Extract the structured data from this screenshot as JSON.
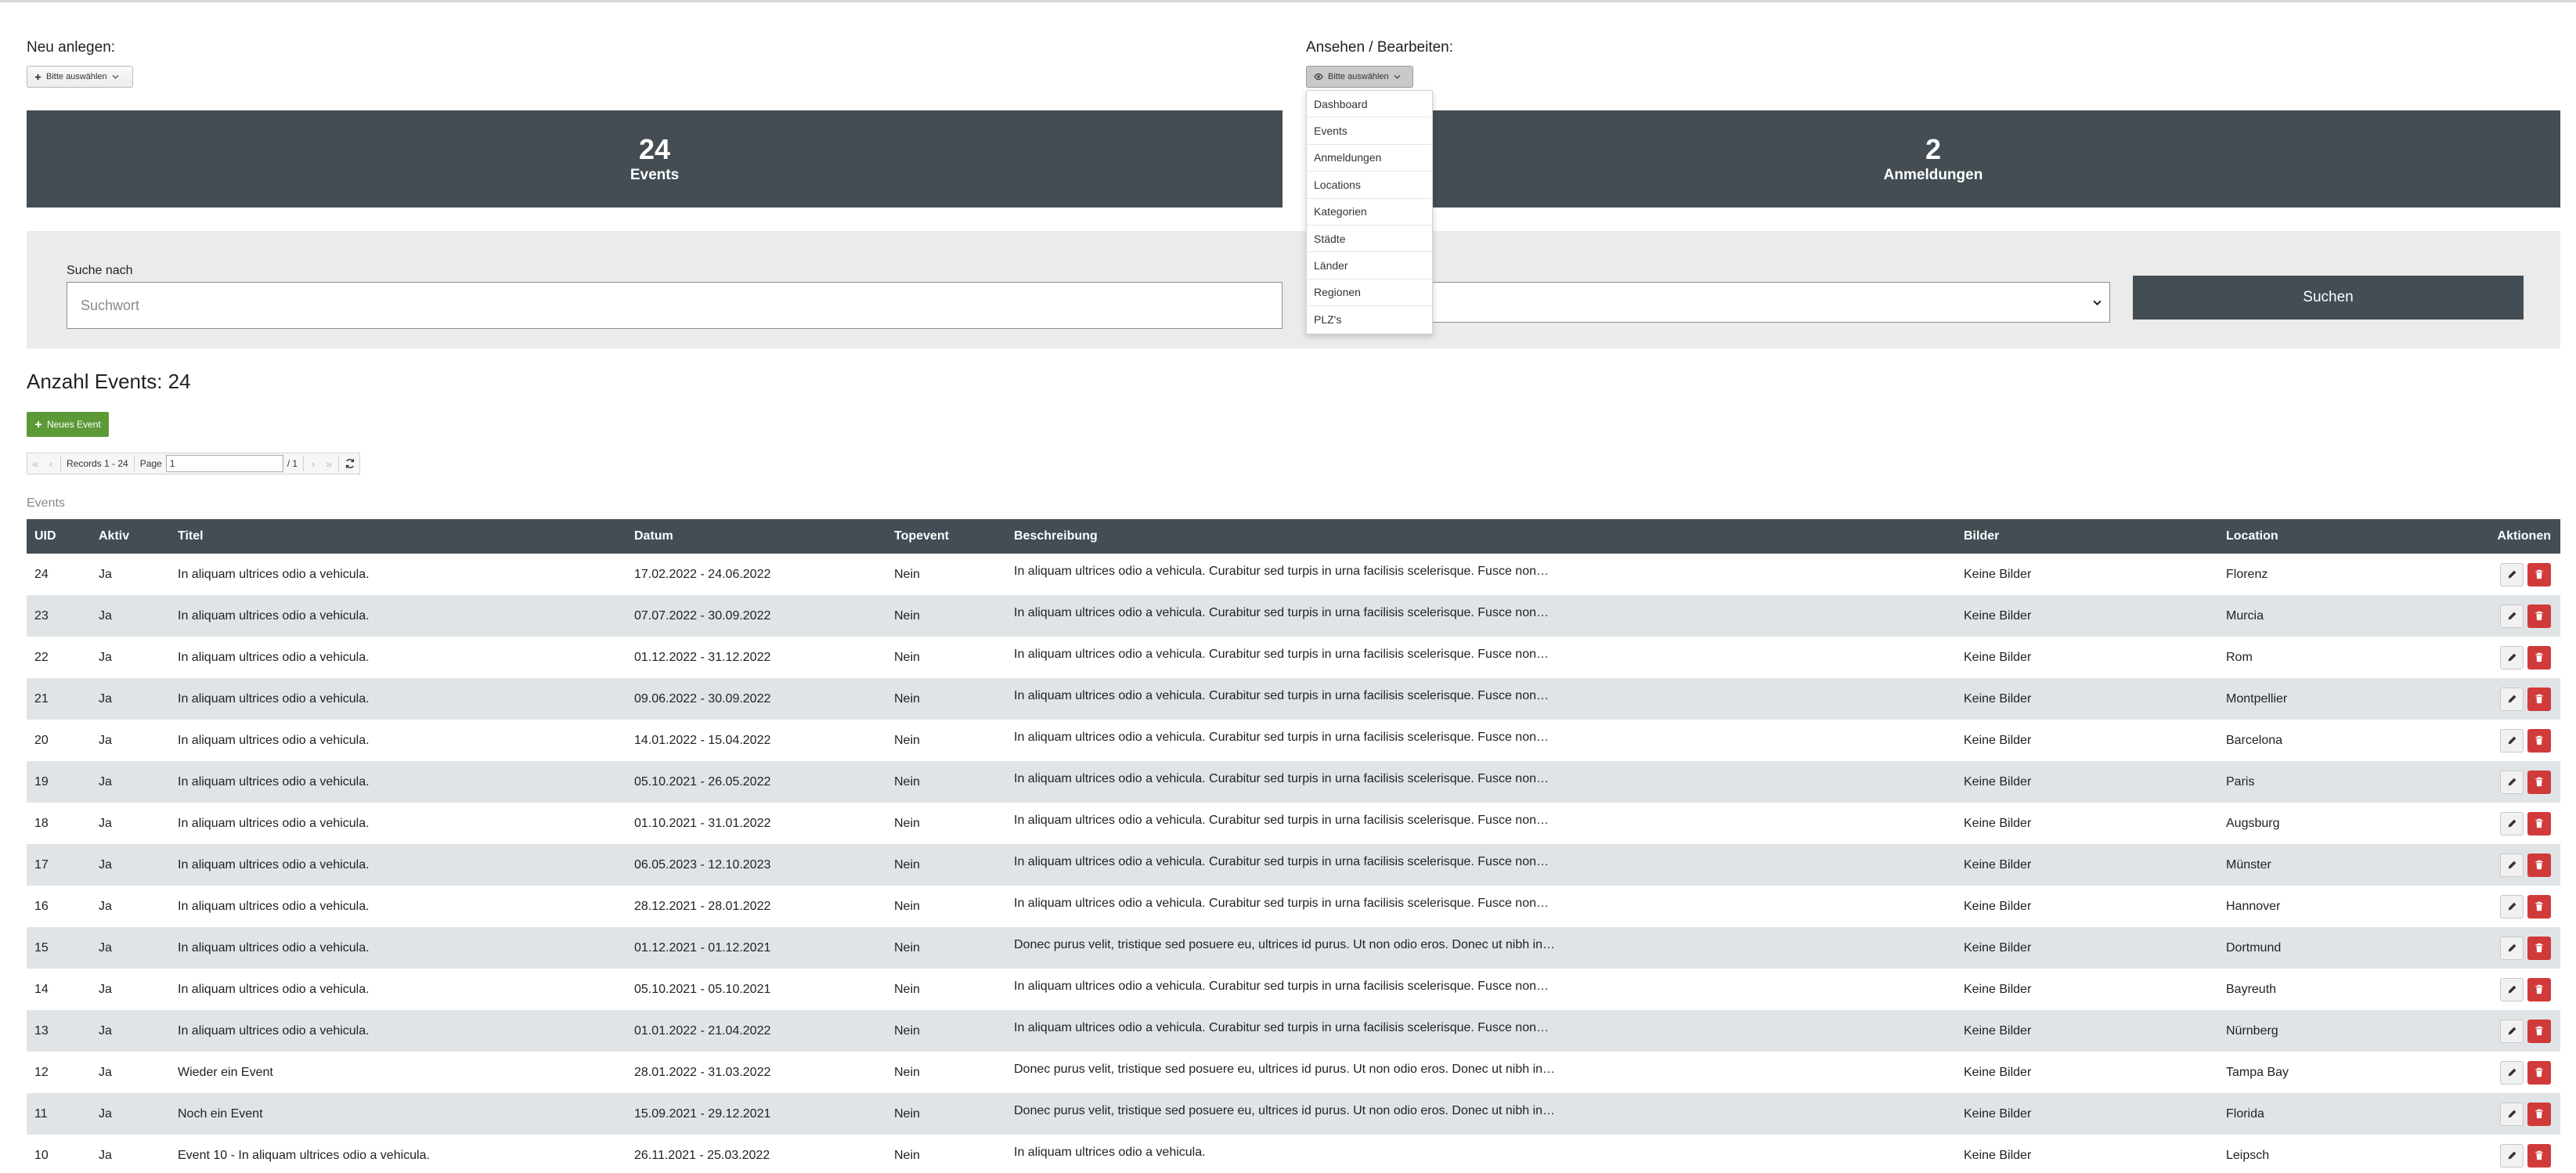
{
  "create": {
    "label": "Neu anlegen:",
    "select_label": "Bitte auswählen"
  },
  "view": {
    "label": "Ansehen / Bearbeiten:",
    "select_label": "Bitte auswählen",
    "menu": [
      "Dashboard",
      "Events",
      "Anmeldungen",
      "Locations",
      "Kategorien",
      "Städte",
      "Länder",
      "Regionen",
      "PLZ's"
    ]
  },
  "stats": [
    {
      "value": "24",
      "label": "Events"
    },
    {
      "value": "2",
      "label": "Anmeldungen"
    }
  ],
  "search": {
    "label": "Suche nach",
    "placeholder": "Suchwort",
    "button": "Suchen"
  },
  "count_heading": "Anzahl Events: 24",
  "new_button": "Neues Event",
  "pager": {
    "records": "Records 1 - 24",
    "page_label": "Page",
    "page_value": "1",
    "page_total": "/ 1"
  },
  "table": {
    "caption": "Events",
    "headers": [
      "UID",
      "Aktiv",
      "Titel",
      "Datum",
      "Topevent",
      "Beschreibung",
      "Bilder",
      "Location",
      "Aktionen"
    ],
    "rows": [
      [
        "24",
        "Ja",
        "In aliquam ultrices odio a vehicula.",
        "17.02.2022 - 24.06.2022",
        "Nein",
        "In aliquam ultrices odio a vehicula. Curabitur sed turpis in urna facilisis scelerisque. Fusce non…",
        "Keine Bilder",
        "Florenz"
      ],
      [
        "23",
        "Ja",
        "In aliquam ultrices odio a vehicula.",
        "07.07.2022 - 30.09.2022",
        "Nein",
        "In aliquam ultrices odio a vehicula. Curabitur sed turpis in urna facilisis scelerisque. Fusce non…",
        "Keine Bilder",
        "Murcia"
      ],
      [
        "22",
        "Ja",
        "In aliquam ultrices odio a vehicula.",
        "01.12.2022 - 31.12.2022",
        "Nein",
        "In aliquam ultrices odio a vehicula. Curabitur sed turpis in urna facilisis scelerisque. Fusce non…",
        "Keine Bilder",
        "Rom"
      ],
      [
        "21",
        "Ja",
        "In aliquam ultrices odio a vehicula.",
        "09.06.2022 - 30.09.2022",
        "Nein",
        "In aliquam ultrices odio a vehicula. Curabitur sed turpis in urna facilisis scelerisque. Fusce non…",
        "Keine Bilder",
        "Montpellier"
      ],
      [
        "20",
        "Ja",
        "In aliquam ultrices odio a vehicula.",
        "14.01.2022 - 15.04.2022",
        "Nein",
        "In aliquam ultrices odio a vehicula. Curabitur sed turpis in urna facilisis scelerisque. Fusce non…",
        "Keine Bilder",
        "Barcelona"
      ],
      [
        "19",
        "Ja",
        "In aliquam ultrices odio a vehicula.",
        "05.10.2021 - 26.05.2022",
        "Nein",
        "In aliquam ultrices odio a vehicula. Curabitur sed turpis in urna facilisis scelerisque. Fusce non…",
        "Keine Bilder",
        "Paris"
      ],
      [
        "18",
        "Ja",
        "In aliquam ultrices odio a vehicula.",
        "01.10.2021 - 31.01.2022",
        "Nein",
        "In aliquam ultrices odio a vehicula. Curabitur sed turpis in urna facilisis scelerisque. Fusce non…",
        "Keine Bilder",
        "Augsburg"
      ],
      [
        "17",
        "Ja",
        "In aliquam ultrices odio a vehicula.",
        "06.05.2023 - 12.10.2023",
        "Nein",
        "In aliquam ultrices odio a vehicula. Curabitur sed turpis in urna facilisis scelerisque. Fusce non…",
        "Keine Bilder",
        "Münster"
      ],
      [
        "16",
        "Ja",
        "In aliquam ultrices odio a vehicula.",
        "28.12.2021 - 28.01.2022",
        "Nein",
        "In aliquam ultrices odio a vehicula. Curabitur sed turpis in urna facilisis scelerisque. Fusce non…",
        "Keine Bilder",
        "Hannover"
      ],
      [
        "15",
        "Ja",
        "In aliquam ultrices odio a vehicula.",
        "01.12.2021 - 01.12.2021",
        "Nein",
        "Donec purus velit, tristique sed posuere eu, ultrices id purus. Ut non odio eros. Donec ut nibh in…",
        "Keine Bilder",
        "Dortmund"
      ],
      [
        "14",
        "Ja",
        "In aliquam ultrices odio a vehicula.",
        "05.10.2021 - 05.10.2021",
        "Nein",
        "In aliquam ultrices odio a vehicula. Curabitur sed turpis in urna facilisis scelerisque. Fusce non…",
        "Keine Bilder",
        "Bayreuth"
      ],
      [
        "13",
        "Ja",
        "In aliquam ultrices odio a vehicula.",
        "01.01.2022 - 21.04.2022",
        "Nein",
        "In aliquam ultrices odio a vehicula. Curabitur sed turpis in urna facilisis scelerisque. Fusce non…",
        "Keine Bilder",
        "Nürnberg"
      ],
      [
        "12",
        "Ja",
        "Wieder ein Event",
        "28.01.2022 - 31.03.2022",
        "Nein",
        "Donec purus velit, tristique sed posuere eu, ultrices id purus. Ut non odio eros. Donec ut nibh in…",
        "Keine Bilder",
        "Tampa Bay"
      ],
      [
        "11",
        "Ja",
        "Noch ein Event",
        "15.09.2021 - 29.12.2021",
        "Nein",
        "Donec purus velit, tristique sed posuere eu, ultrices id purus. Ut non odio eros. Donec ut nibh in…",
        "Keine Bilder",
        "Florida"
      ],
      [
        "10",
        "Ja",
        "Event 10 - In aliquam ultrices odio a vehicula.",
        "26.11.2021 - 25.03.2022",
        "Nein",
        "In aliquam ultrices odio a vehicula.",
        "Keine Bilder",
        "Leipsch"
      ]
    ]
  },
  "colors": {
    "dark_slate": "#434d53",
    "row_alt": "#e0e4e7",
    "new_green": "#5c9a37",
    "delete_red": "#d13a3a"
  }
}
